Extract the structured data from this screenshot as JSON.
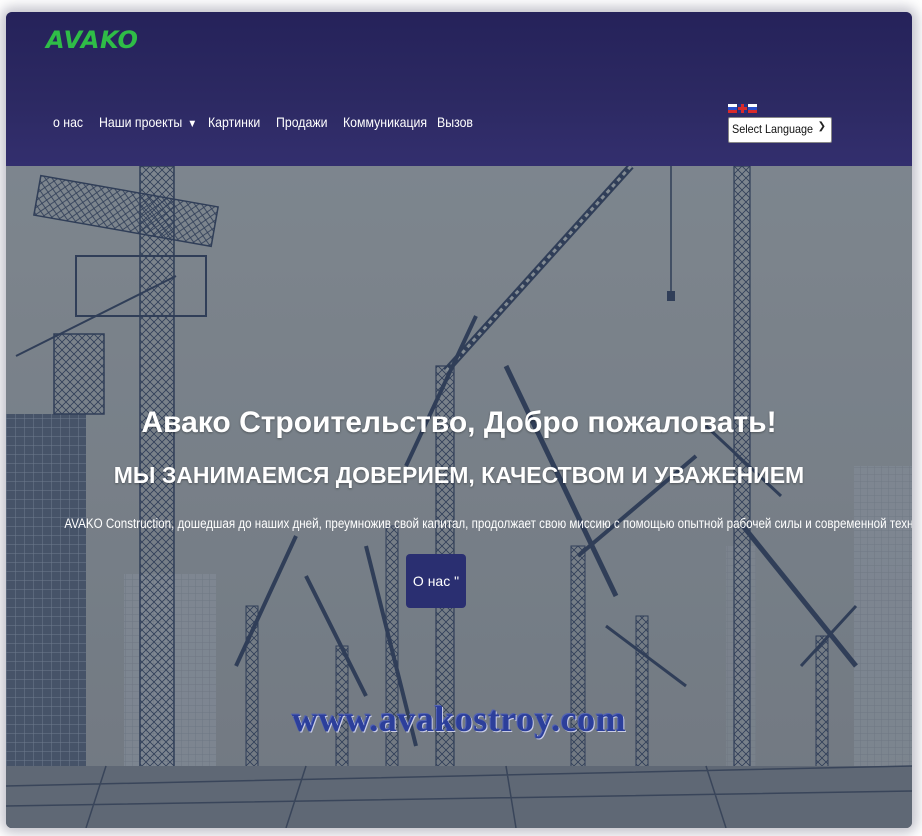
{
  "header": {
    "logo": "AVAKO",
    "nav": [
      {
        "label": "о нас"
      },
      {
        "label": "Наши проекты",
        "has_dropdown": true
      },
      {
        "label": "Картинки"
      },
      {
        "label": "Продажи"
      },
      {
        "label": "Коммуникация"
      },
      {
        "label": "Вызов"
      }
    ],
    "language_select": {
      "value": "Select Language"
    }
  },
  "hero": {
    "title": "Авако Строительство, Добро пожаловать!",
    "subtitle": "МЫ ЗАНИМАЕМСЯ ДОВЕРИЕМ, КАЧЕСТВОМ И УВАЖЕНИЕМ",
    "description": "AVAKO Construction, дошедшая до наших дней, преумножив свой капитал, продолжает свою миссию с помощью опытной рабочей силы и современной техники.",
    "button_label": "О нас \""
  },
  "watermark": "www.avakostroy.com",
  "colors": {
    "header_bg": "#2c2962",
    "logo": "#2fbd47",
    "hero_button": "#2a2f71",
    "hero_overlay": "#7d848c",
    "watermark": "#2c3f9b"
  }
}
